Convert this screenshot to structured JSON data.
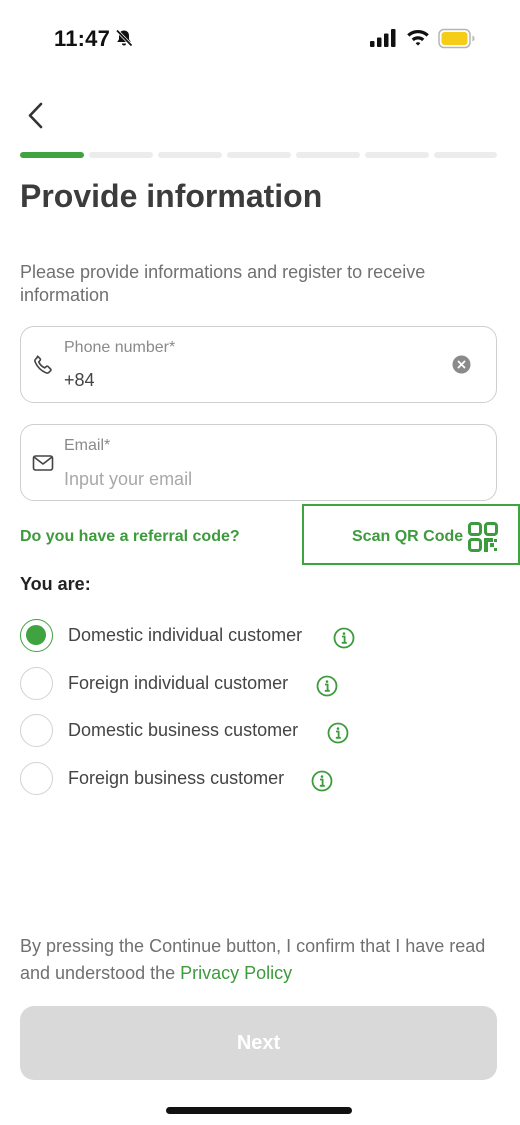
{
  "status_bar": {
    "time": "11:47",
    "icons": [
      "bell-slash-icon",
      "signal-icon",
      "wifi-icon",
      "battery-icon"
    ],
    "battery_color": "#f5cc16"
  },
  "nav": {
    "back_icon": "chevron-left-icon"
  },
  "progress": {
    "total_steps": 7,
    "current_step": 1,
    "active_color": "#3fa33f",
    "inactive_color": "#ececec"
  },
  "header": {
    "title": "Provide information",
    "subtitle": "Please provide informations and register to receive information"
  },
  "form": {
    "phone": {
      "label": "Phone number*",
      "value": "+84",
      "icon": "phone-icon",
      "clear_icon": "clear-icon"
    },
    "email": {
      "label": "Email*",
      "value": "",
      "placeholder": "Input your email",
      "icon": "mail-icon"
    }
  },
  "referral": {
    "link_label": "Do you have a referral code?",
    "scan_label": "Scan QR Code",
    "scan_icon": "qr-code-icon"
  },
  "customer_type": {
    "heading": "You are:",
    "selected_index": 0,
    "options": [
      {
        "label": "Domestic individual customer"
      },
      {
        "label": "Foreign individual customer"
      },
      {
        "label": "Domestic business customer"
      },
      {
        "label": "Foreign business customer"
      }
    ]
  },
  "footer": {
    "disclaimer_text": "By pressing the Continue button, I confirm that I have read and understood the ",
    "privacy_link": "Privacy Policy",
    "next_label": "Next"
  },
  "colors": {
    "accent": "#3fa33f",
    "disabled_button": "#d9d9d9"
  }
}
